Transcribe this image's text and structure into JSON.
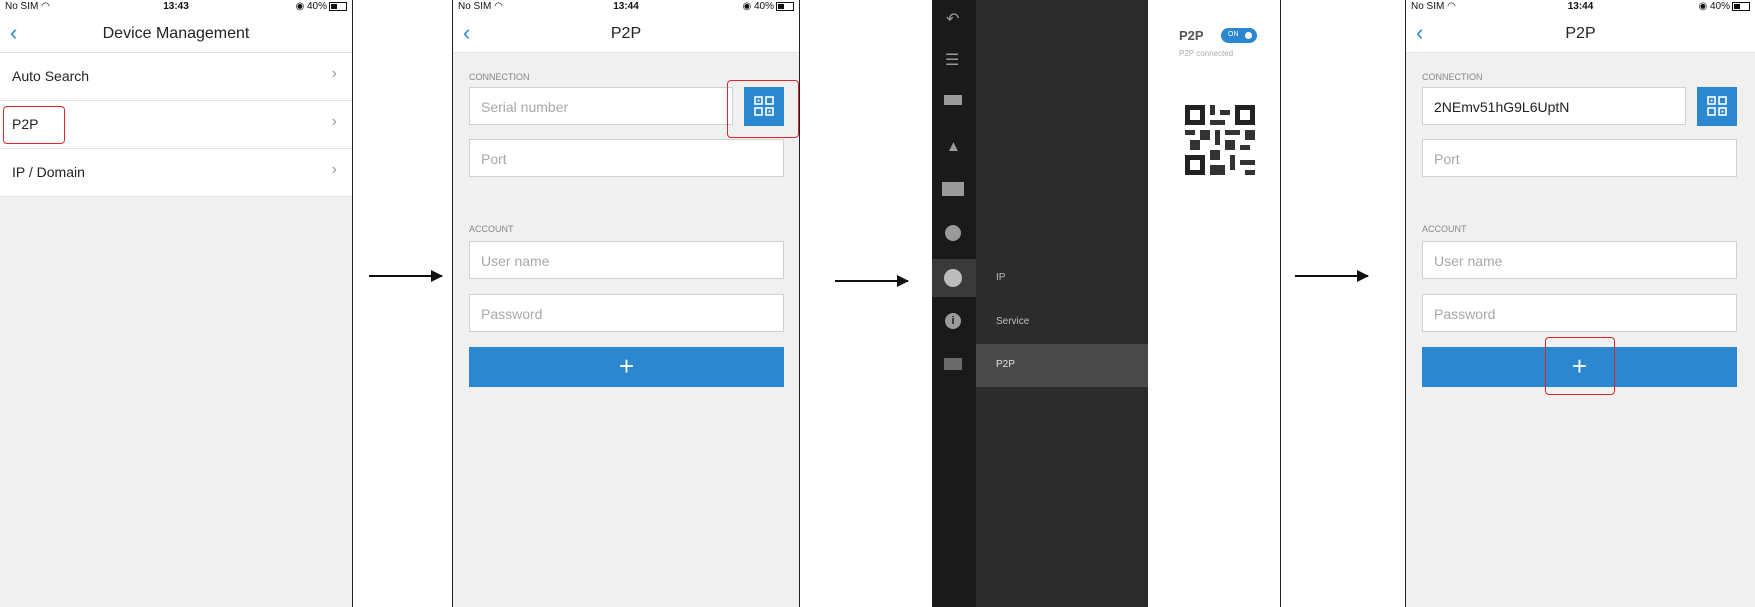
{
  "status": {
    "carrier": "No SIM",
    "battery": "40%"
  },
  "screen1": {
    "time": "13:43",
    "title": "Device Management",
    "items": [
      {
        "label": "Auto Search"
      },
      {
        "label": "P2P"
      },
      {
        "label": "IP / Domain"
      }
    ]
  },
  "screen2": {
    "time": "13:44",
    "title": "P2P",
    "connection_label": "CONNECTION",
    "serial_placeholder": "Serial number",
    "port_placeholder": "Port",
    "account_label": "ACCOUNT",
    "username_placeholder": "User name",
    "password_placeholder": "Password",
    "add_label": "+"
  },
  "screen3": {
    "p2p_title": "P2P",
    "toggle_label": "ON",
    "status_text": "P2P connected",
    "menu_items": [
      {
        "label": "IP"
      },
      {
        "label": "Service"
      },
      {
        "label": "P2P"
      }
    ]
  },
  "screen4": {
    "time": "13:44",
    "title": "P2P",
    "connection_label": "CONNECTION",
    "serial_value": "2NEmv51hG9L6UptN",
    "port_placeholder": "Port",
    "account_label": "ACCOUNT",
    "username_placeholder": "User name",
    "password_placeholder": "Password",
    "add_label": "+"
  },
  "colors": {
    "accent": "#2a87d0",
    "highlight": "#e0262a",
    "dark_sidebar": "#1c1c1c",
    "dark_menu": "#2b2b2b"
  }
}
